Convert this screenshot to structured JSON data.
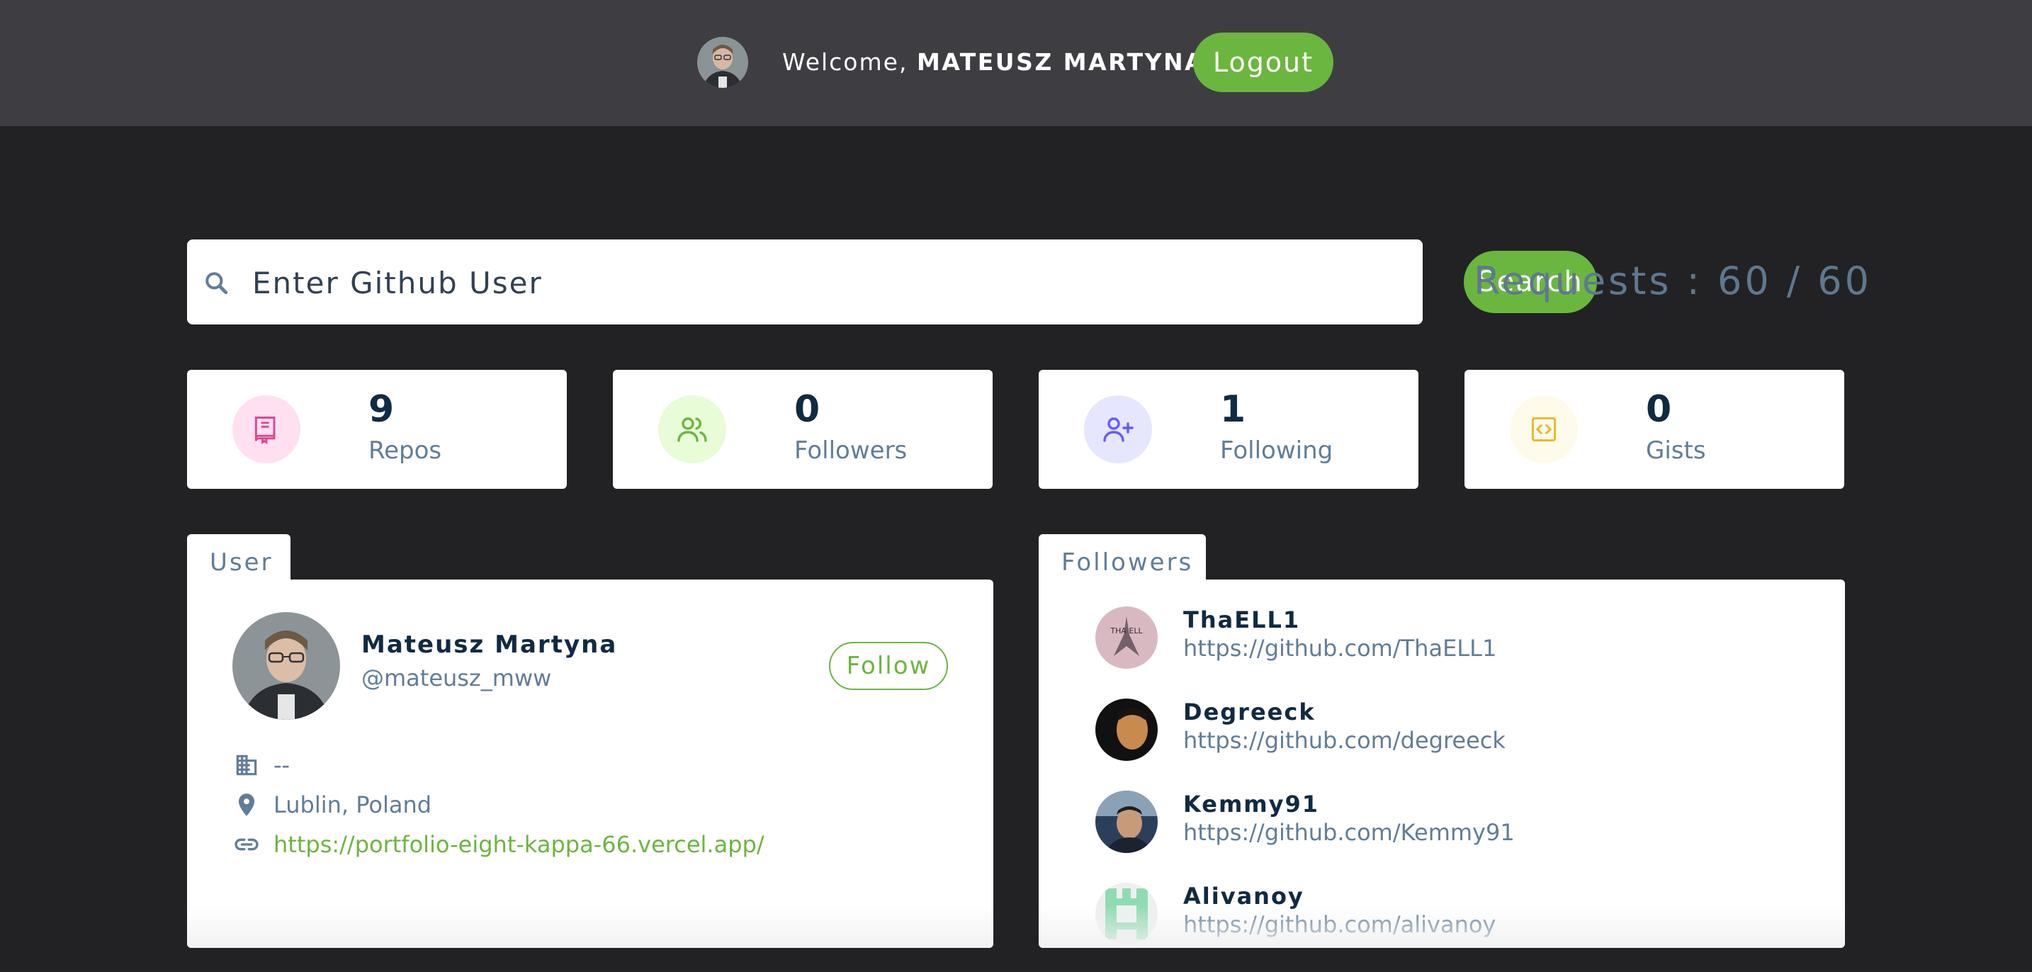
{
  "navbar": {
    "welcome_prefix": "Welcome, ",
    "user_name": "MATEUSZ MARTYNA",
    "logout_label": "Logout"
  },
  "search": {
    "placeholder": "Enter Github User",
    "button_label": "Search",
    "requests_text": "Requests : 60 / 60"
  },
  "stats": [
    {
      "value": "9",
      "label": "Repos",
      "icon": "book-icon",
      "color": "#da4a91",
      "bg": "#ffe0f0"
    },
    {
      "value": "0",
      "label": "Followers",
      "icon": "users-icon",
      "color": "#6bb63f",
      "bg": "#e8fcd8"
    },
    {
      "value": "1",
      "label": "Following",
      "icon": "user-plus-icon",
      "color": "#645cff",
      "bg": "#e6e6ff"
    },
    {
      "value": "0",
      "label": "Gists",
      "icon": "code-icon",
      "color": "#f0b429",
      "bg": "#fffbea"
    }
  ],
  "user_panel": {
    "tab_label": "User",
    "name": "Mateusz Martyna",
    "login": "@mateusz_mww",
    "follow_label": "Follow",
    "company": "--",
    "location": "Lublin, Poland",
    "blog": "https://portfolio-eight-kappa-66.vercel.app/"
  },
  "followers_panel": {
    "tab_label": "Followers",
    "items": [
      {
        "login": "ThaELL1",
        "url": "https://github.com/ThaELL1"
      },
      {
        "login": "Degreeck",
        "url": "https://github.com/degreeck"
      },
      {
        "login": "Kemmy91",
        "url": "https://github.com/Kemmy91"
      },
      {
        "login": "Alivanoy",
        "url": "https://github.com/alivanoy"
      }
    ]
  },
  "colors": {
    "accent": "#6bb63f",
    "navbar_bg": "#3e3e42",
    "page_bg": "#222225",
    "heading": "#102a43",
    "muted": "#617d98"
  }
}
